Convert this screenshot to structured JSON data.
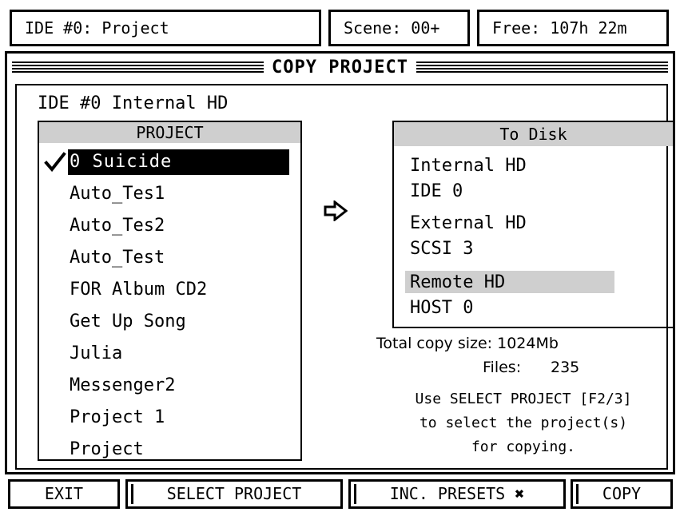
{
  "status_bar": {
    "drive": "IDE #0: Project",
    "scene": "Scene: 00+",
    "free": "Free: 107h 22m"
  },
  "dialog": {
    "title": "COPY PROJECT",
    "source_drive": "IDE #0  Internal HD",
    "project_list": {
      "header": "PROJECT",
      "items": [
        "0 Suicide",
        "Auto_Tes1",
        "Auto_Tes2",
        "Auto_Test",
        "FOR Album CD2",
        "Get Up Song",
        "Julia",
        "Messenger2",
        "Project 1",
        "Project"
      ],
      "selected_index": 0,
      "checked_index": 0
    },
    "to_disk": {
      "header": "To Disk",
      "options": [
        {
          "name": "Internal HD",
          "id": "IDE 0"
        },
        {
          "name": "External HD",
          "id": "SCSI 3"
        },
        {
          "name": "Remote HD",
          "id": "HOST 0"
        }
      ],
      "highlighted_index": 2
    },
    "total_copy_size": "Total copy size: 1024Mb",
    "files_label": "Files:",
    "files_count": "235",
    "help_lines": [
      "Use SELECT PROJECT [F2/3]",
      "to select the project(s)",
      "for copying."
    ]
  },
  "function_keys": {
    "exit": "EXIT",
    "select_project": "SELECT PROJECT",
    "inc_presets": "INC. PRESETS ✖",
    "copy": "COPY"
  },
  "icons": {
    "check": "check-icon",
    "arrow": "right-arrow-icon"
  }
}
